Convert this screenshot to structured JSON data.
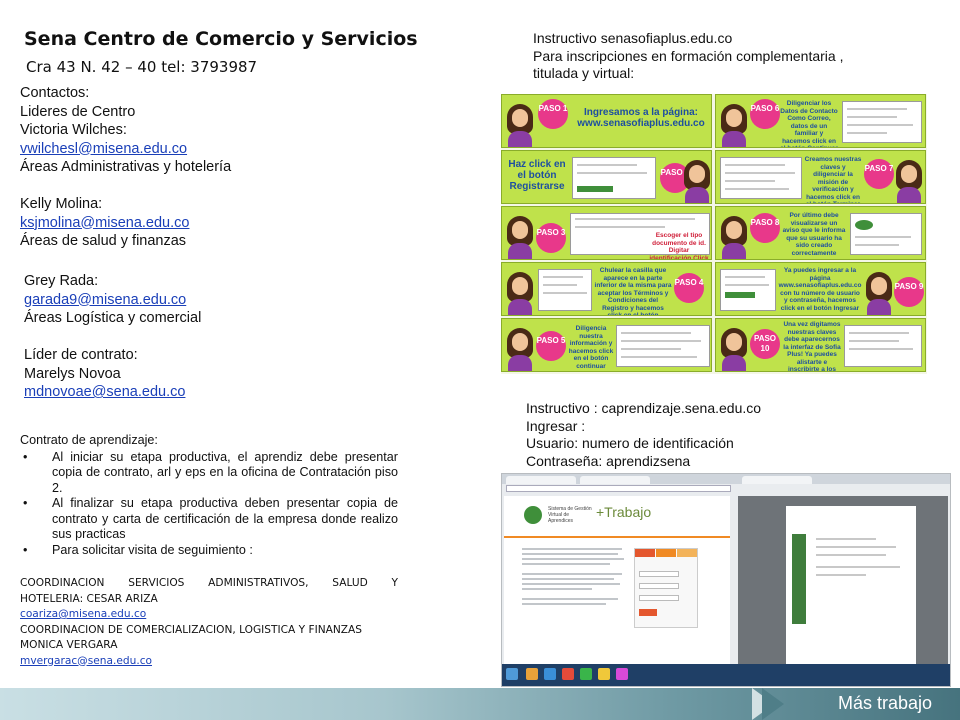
{
  "header": {
    "title": "Sena  Centro de Comercio  y Servicios",
    "address": "Cra 43 N. 42 – 40  tel: 3793987"
  },
  "contacts": {
    "heading": "Contactos:",
    "subheading": "Lideres de Centro",
    "people": [
      {
        "name": "Victoria Wilches:",
        "email": "vwilchesl@misena.edu.co",
        "areas": " Áreas  Administrativas  y hotelería"
      },
      {
        "name": "Kelly Molina:",
        "email": "ksjmolina@misena.edu.co",
        "areas": "Áreas de salud y  finanzas"
      },
      {
        "name": "Grey Rada:",
        "email": "garada9@misena.edu.co",
        "areas": "Áreas Logística y comercial"
      }
    ],
    "contract_leader": {
      "label": "Líder de contrato:",
      "name": "Marelys Novoa",
      "email": "mdnovoae@sena.edu.co"
    }
  },
  "contract": {
    "heading": "Contrato de aprendizaje:",
    "items": [
      "Al iniciar su etapa productiva, el aprendiz debe presentar  copia de contrato, arl y eps en la oficina de Contratación piso 2.",
      "Al finalizar su etapa productiva deben presentar copia de contrato y carta de certificación de la empresa donde realizo sus practicas",
      "Para solicitar visita de seguimiento :"
    ],
    "coordinators": [
      {
        "line1": "COORDINACION SERVICIOS ADMINISTRATIVOS, SALUD Y",
        "line2": "HOTELERIA: CESAR ARIZA",
        "email": "coariza@misena.edu.co"
      },
      {
        "line1": "COORDINACION  DE COMERCIALIZACION, LOGISTICA Y FINANZAS",
        "line2": "MONICA VERGARA",
        "email": "mvergarac@sena.edu.co"
      }
    ]
  },
  "instructivo_sofia": {
    "line1": "Instructivo  senasofiaplus.edu.co",
    "line2": "Para inscripciones en formación complementaria ,",
    "line3": "titulada y virtual:"
  },
  "steps": [
    {
      "label": "PASO 1",
      "text": "Ingresamos a la página: www.senasofiaplus.edu.co"
    },
    {
      "label": "PASO 6",
      "text": "Diligenciar los Datos de Contacto Como Correo, datos de un familiar y hacemos click en el botón Continuar"
    },
    {
      "label": "PASO 2",
      "text": "Haz click en el botón Registrarse"
    },
    {
      "label": "PASO 7",
      "text": "Creamos nuestras claves y diligenciar la misión de verificación y hacemos click en el botón Terminar"
    },
    {
      "label": "PASO 3",
      "text": "Escoger el tipo documento de id. Digitar identificación Click en el botón Validar"
    },
    {
      "label": "PASO 8",
      "text": "Por último debe visualizarse un aviso que le informa que su usuario ha sido creado correctamente"
    },
    {
      "label": "PASO 4",
      "text": "Chulear la casilla que aparece en la parte inferior de la misma para aceptar los Términos y Condiciones del Registro y hacemos click en el botón Continuar"
    },
    {
      "label": "PASO 9",
      "text": "Ya puedes ingresar a la página www.senasofiaplus.edu.co con tu número de usuario y contraseña, hacemos click en el botón Ingresar"
    },
    {
      "label": "PASO 5",
      "text": "Diligencia nuestra información y hacemos click en el botón continuar"
    },
    {
      "label": "PASO 10",
      "text": "Una vez digitamos nuestras claves debe aparecernos la interfaz de Sofia Plus! Ya puedes alistarte e inscribirte a los cursos virtuales del SENA!"
    }
  ],
  "instructivo_caprendizaje": {
    "line1": "Instructivo  : caprendizaje.sena.edu.co",
    "line2": "Ingresar :",
    "line3": "Usuario: numero de identificación",
    "line4": "Contraseña: aprendizsena"
  },
  "screenshot": {
    "brand_text": "+Trabajo",
    "system_name": "Sistema de Gestión Virtual de Aprendices"
  },
  "footer": {
    "text": "Más trabajo"
  },
  "colors": {
    "link": "#1a3fb8",
    "step_bg": "#bfe24b",
    "paso_badge": "#e8388a",
    "footer_dark": "#46737e"
  }
}
